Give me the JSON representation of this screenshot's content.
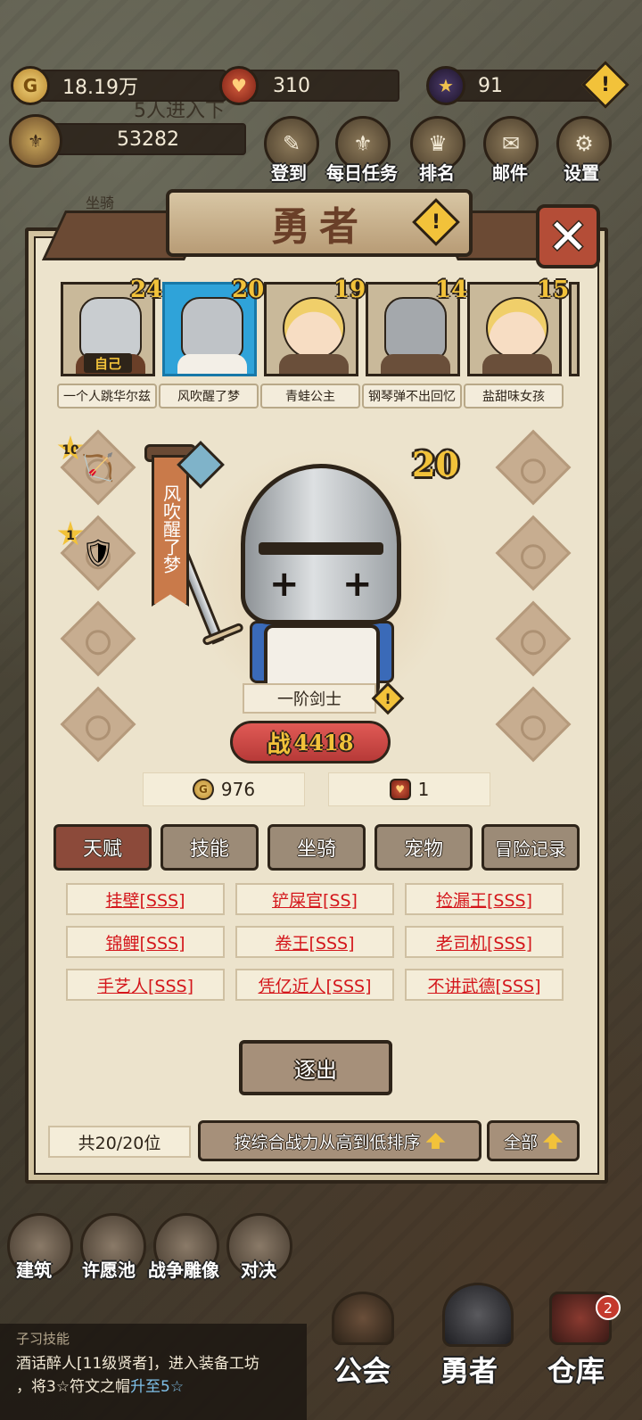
{
  "resources": {
    "gold": "18.19万",
    "gem": "310",
    "star": "91",
    "power_total": "53282",
    "bg_text": "5人进入下",
    "side_text": "坐骑"
  },
  "top_nav": [
    {
      "label": "登到",
      "icon": "checkin-icon"
    },
    {
      "label": "每日任务",
      "icon": "daily-task-icon"
    },
    {
      "label": "排名",
      "icon": "rank-icon"
    },
    {
      "label": "邮件",
      "icon": "mail-icon"
    },
    {
      "label": "设置",
      "icon": "settings-icon"
    }
  ],
  "panel": {
    "title": "勇者",
    "close": "✕",
    "warn": "!"
  },
  "heroes": [
    {
      "name": "一个人跳华尔兹",
      "level": "24",
      "tag": "自己"
    },
    {
      "name": "风吹醒了梦",
      "level": "20"
    },
    {
      "name": "青蛙公主",
      "level": "19"
    },
    {
      "name": "钢琴弹不出回忆",
      "level": "14"
    },
    {
      "name": "盐甜味女孩",
      "level": "15"
    }
  ],
  "selected": {
    "name": "风吹醒了梦",
    "level": "20",
    "class": "一阶剑士",
    "power_label": "战",
    "power": "4418",
    "gold_cost": "976",
    "gem_cost": "1",
    "equip_left": [
      {
        "star": "10",
        "icon": "crossbow-icon"
      },
      {
        "star": "1",
        "icon": "armor-icon"
      }
    ]
  },
  "tabs": [
    "天赋",
    "技能",
    "坐骑",
    "宠物",
    "冒险记录"
  ],
  "talents": [
    "挂壁[SSS]",
    "铲屎官[SS]",
    "捡漏王[SSS]",
    "锦鲤[SSS]",
    "卷王[SSS]",
    "老司机[SSS]",
    "手艺人[SSS]",
    "凭亿近人[SSS]",
    "不讲武德[SSS]"
  ],
  "expel": "逐出",
  "count": "共20/20位",
  "sort": "按综合战力从高到低排序",
  "filter": "全部",
  "bottom_icons": [
    {
      "label": "建筑",
      "icon": "building-icon"
    },
    {
      "label": "许愿池",
      "icon": "wish-pool-icon"
    },
    {
      "label": "战争雕像",
      "icon": "war-statue-icon"
    },
    {
      "label": "对决",
      "icon": "duel-icon"
    }
  ],
  "skill": {
    "title": "子习技能",
    "line1": "酒话醉人[11级贤者]，进入装备工坊",
    "line2_a": "，将3☆符文之帽",
    "line2_b": "升至5☆"
  },
  "bottom_nav": [
    {
      "label": "公会"
    },
    {
      "label": "勇者"
    },
    {
      "label": "仓库",
      "badge": "2"
    }
  ]
}
